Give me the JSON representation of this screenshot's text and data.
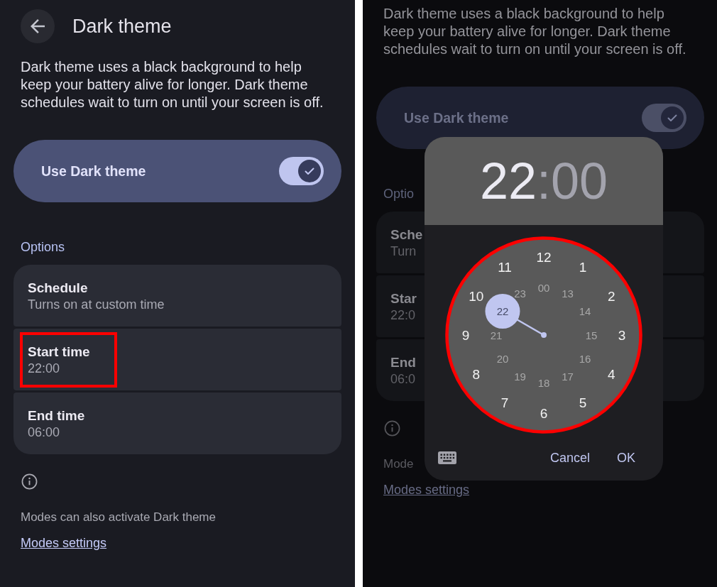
{
  "left_screen": {
    "title": "Dark theme",
    "description": "Dark theme uses a black background to help keep your battery alive for longer. Dark theme schedules wait to turn on until your screen is off.",
    "toggle": {
      "label": "Use Dark theme",
      "on": true
    },
    "section_header": "Options",
    "options": [
      {
        "title": "Schedule",
        "subtitle": "Turns on at custom time",
        "highlighted": false
      },
      {
        "title": "Start time",
        "subtitle": "22:00",
        "highlighted": true
      },
      {
        "title": "End time",
        "subtitle": "06:00",
        "highlighted": false
      }
    ],
    "footer_note": "Modes can also activate Dark theme",
    "footer_link": "Modes settings"
  },
  "right_screen": {
    "description": "Dark theme uses a black background to help keep your battery alive for longer. Dark theme schedules wait to turn on until your screen is off.",
    "toggle": {
      "label": "Use Dark theme",
      "on": true
    },
    "section_header": "Optio",
    "options": [
      {
        "title": "Sche",
        "subtitle": "Turn"
      },
      {
        "title": "Star",
        "subtitle": "22:0"
      },
      {
        "title": "End",
        "subtitle": "06:0"
      }
    ],
    "footer_note": "Mode",
    "footer_link": "Modes settings",
    "time_picker": {
      "hour": {
        "text": "22",
        "selected": true
      },
      "separator": ":",
      "minute": {
        "text": "00",
        "selected": false
      },
      "dial": {
        "highlighted": true,
        "outer": [
          {
            "label": "12",
            "selected": false
          },
          {
            "label": "1",
            "selected": false
          },
          {
            "label": "2",
            "selected": false
          },
          {
            "label": "3",
            "selected": false
          },
          {
            "label": "4",
            "selected": false
          },
          {
            "label": "5",
            "selected": false
          },
          {
            "label": "6",
            "selected": false
          },
          {
            "label": "7",
            "selected": false
          },
          {
            "label": "8",
            "selected": false
          },
          {
            "label": "9",
            "selected": false
          },
          {
            "label": "10",
            "selected": false
          },
          {
            "label": "11",
            "selected": false
          }
        ],
        "inner": [
          {
            "label": "00",
            "selected": false
          },
          {
            "label": "13",
            "selected": false
          },
          {
            "label": "14",
            "selected": false
          },
          {
            "label": "15",
            "selected": false
          },
          {
            "label": "16",
            "selected": false
          },
          {
            "label": "17",
            "selected": false
          },
          {
            "label": "18",
            "selected": false
          },
          {
            "label": "19",
            "selected": false
          },
          {
            "label": "20",
            "selected": false
          },
          {
            "label": "21",
            "selected": false
          },
          {
            "label": "22",
            "selected": true
          },
          {
            "label": "23",
            "selected": false
          }
        ]
      },
      "buttons": [
        "Cancel",
        "OK"
      ]
    }
  }
}
